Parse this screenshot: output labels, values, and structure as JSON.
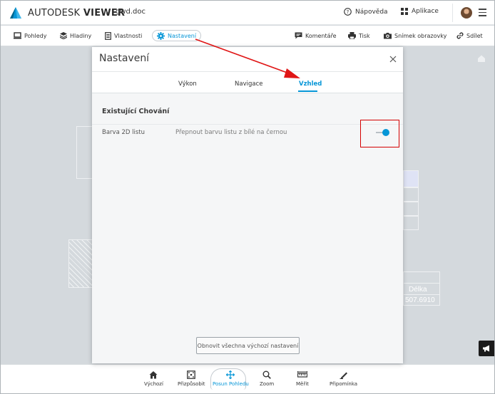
{
  "header": {
    "brand_regular": "AUTODESK",
    "brand_bold": " VIEWER",
    "doc_name": "gwd.doc",
    "help_label": "Nápověda",
    "apps_label": "Aplikace"
  },
  "toolbar": {
    "left": [
      {
        "label": "Pohledy",
        "icon": "monitor-icon"
      },
      {
        "label": "Hladiny",
        "icon": "layers-icon"
      },
      {
        "label": "Vlastnosti",
        "icon": "properties-icon"
      },
      {
        "label": "Nastavení",
        "icon": "gear-icon",
        "active": true
      }
    ],
    "right": [
      {
        "label": "Komentáře",
        "icon": "comment-icon"
      },
      {
        "label": "Tisk",
        "icon": "print-icon"
      },
      {
        "label": "Snímek obrazovky",
        "icon": "camera-icon"
      },
      {
        "label": "Sdílet",
        "icon": "link-icon"
      }
    ]
  },
  "canvas": {
    "bg_label_header": "Délka",
    "bg_label_value": "507.6910"
  },
  "modal": {
    "title": "Nastavení",
    "tabs": [
      {
        "label": "Výkon"
      },
      {
        "label": "Navigace"
      },
      {
        "label": "Vzhled",
        "active": true
      }
    ],
    "section_title": "Existující Chování",
    "option": {
      "label": "Barva 2D listu",
      "description": "Přepnout barvu listu z bílé na černou",
      "enabled": true
    },
    "reset_label": "Obnovit všechna výchozí nastavení"
  },
  "bottom_nav": [
    {
      "label": "Výchozí",
      "icon": "home-icon"
    },
    {
      "label": "Přizpůsobit",
      "icon": "fit-icon"
    },
    {
      "label": "Posun Pohledu",
      "icon": "pan-icon",
      "active": true
    },
    {
      "label": "Zoom",
      "icon": "zoom-icon"
    },
    {
      "label": "Měřit",
      "icon": "ruler-icon"
    },
    {
      "label": "Připomínka",
      "icon": "markup-icon"
    }
  ],
  "colors": {
    "accent": "#0696d7",
    "annotation": "#d40000"
  }
}
